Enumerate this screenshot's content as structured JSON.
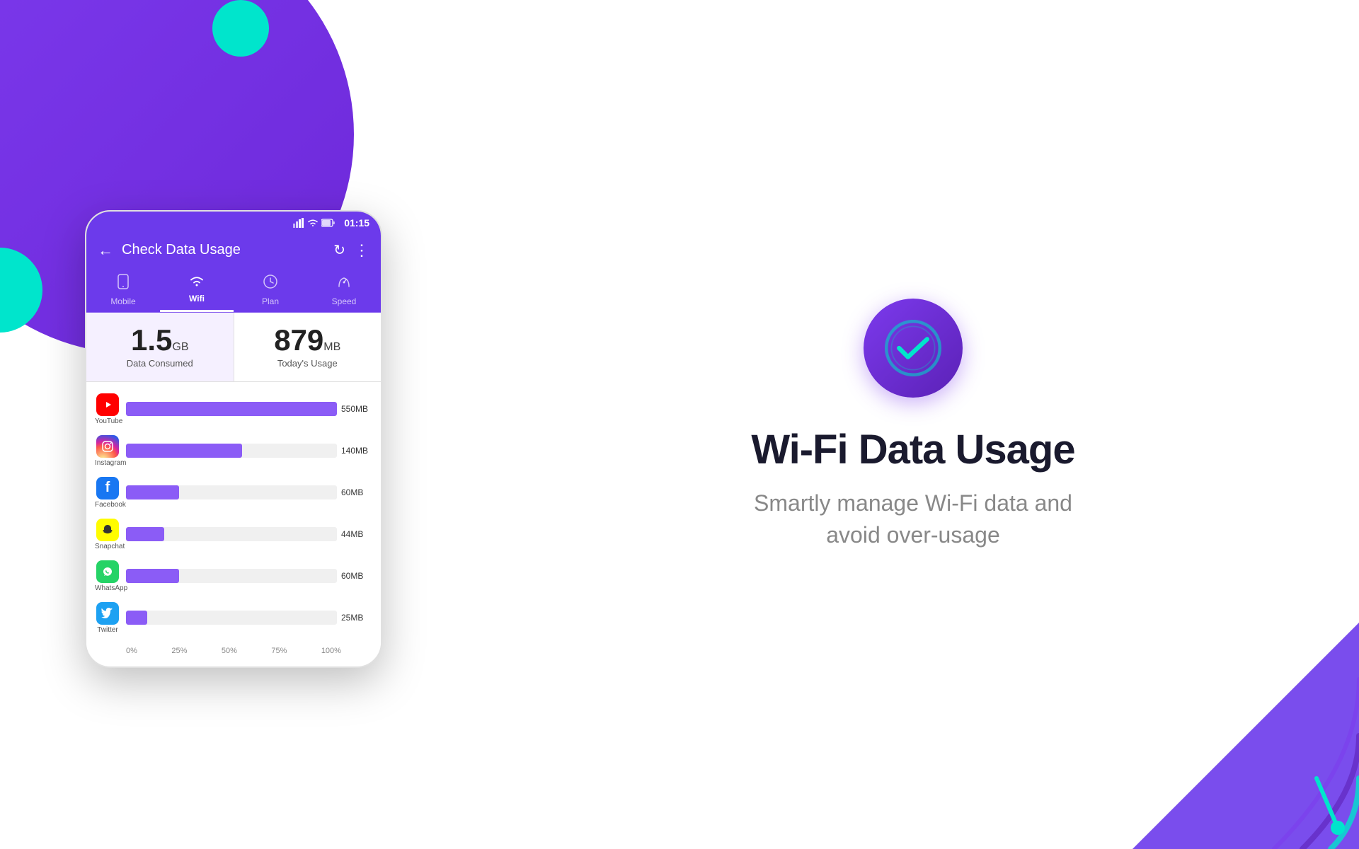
{
  "app": {
    "title": "Wi-Fi Data Usage",
    "subtitle_line1": "Smartly manage Wi-Fi data and",
    "subtitle_line2": "avoid over-usage"
  },
  "status_bar": {
    "time": "01:15"
  },
  "header": {
    "title": "Check Data Usage",
    "back_label": "←",
    "refresh_label": "↻",
    "more_label": "⋮"
  },
  "tabs": [
    {
      "id": "mobile",
      "label": "Mobile",
      "icon": "📱",
      "active": false
    },
    {
      "id": "wifi",
      "label": "Wifi",
      "icon": "📶",
      "active": true
    },
    {
      "id": "plan",
      "label": "Plan",
      "icon": "🕐",
      "active": false
    },
    {
      "id": "speed",
      "label": "Speed",
      "icon": "⚡",
      "active": false
    }
  ],
  "data_summary": {
    "consumed_value": "1.5",
    "consumed_unit": "GB",
    "consumed_label": "Data Consumed",
    "today_value": "879",
    "today_unit": "MB",
    "today_label": "Today's Usage"
  },
  "chart": {
    "apps": [
      {
        "name": "YouTube",
        "value": "550MB",
        "percent": 100,
        "color": "#8b5cf6",
        "icon_type": "youtube"
      },
      {
        "name": "Instagram",
        "value": "140MB",
        "percent": 55,
        "color": "#8b5cf6",
        "icon_type": "instagram"
      },
      {
        "name": "Facebook",
        "value": "60MB",
        "percent": 25,
        "color": "#8b5cf6",
        "icon_type": "facebook"
      },
      {
        "name": "Snapchat",
        "value": "44MB",
        "percent": 18,
        "color": "#8b5cf6",
        "icon_type": "snapchat"
      },
      {
        "name": "WhatsApp",
        "value": "60MB",
        "percent": 25,
        "color": "#8b5cf6",
        "icon_type": "whatsapp"
      },
      {
        "name": "Twitter",
        "value": "25MB",
        "percent": 10,
        "color": "#8b5cf6",
        "icon_type": "twitter"
      }
    ],
    "x_labels": [
      "0%",
      "25%",
      "50%",
      "75%",
      "100%"
    ]
  },
  "colors": {
    "purple_primary": "#6c3aeb",
    "purple_light": "#8b5cf6",
    "cyan": "#00e5cc",
    "white": "#ffffff"
  }
}
